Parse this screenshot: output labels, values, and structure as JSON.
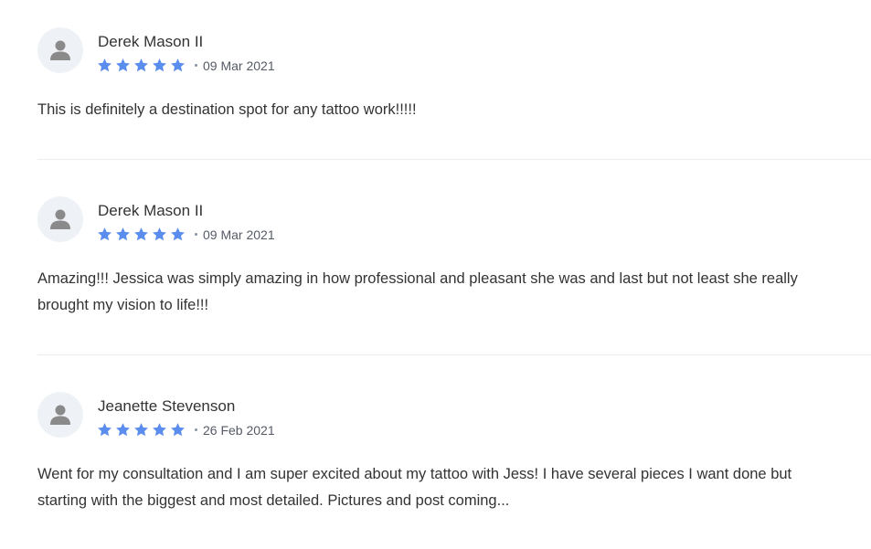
{
  "colors": {
    "star": "#5b8def",
    "avatar_bg": "#eef1f5",
    "avatar_icon": "#8a8a8a"
  },
  "reviews": [
    {
      "author": "Derek Mason II",
      "rating": 5,
      "date": "09 Mar 2021",
      "text": "This is definitely a destination spot for any tattoo work!!!!!"
    },
    {
      "author": "Derek Mason II",
      "rating": 5,
      "date": "09 Mar 2021",
      "text": "Amazing!!! Jessica was simply amazing in how professional and pleasant she was and last but not least she really brought my vision to life!!!"
    },
    {
      "author": "Jeanette Stevenson",
      "rating": 5,
      "date": "26 Feb 2021",
      "text": "Went for my consultation and I am super excited about my tattoo with Jess! I have several pieces I want done but starting with the biggest and most detailed. Pictures and post coming..."
    }
  ]
}
